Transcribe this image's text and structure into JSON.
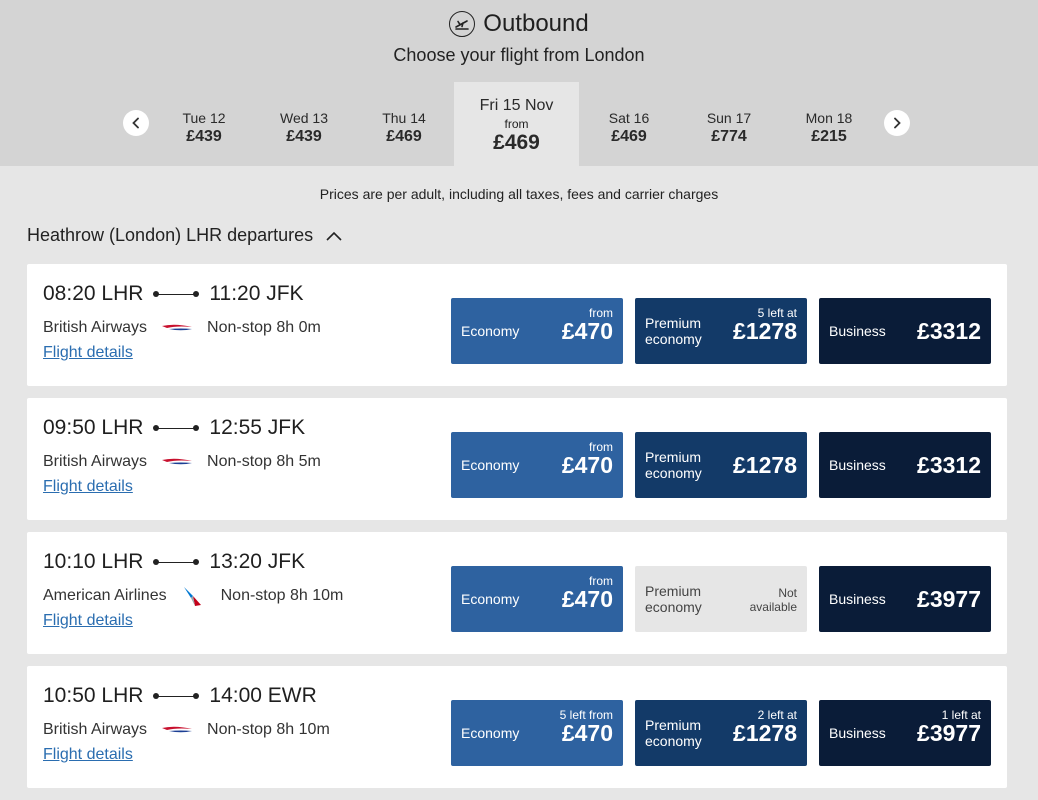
{
  "header": {
    "icon": "plane-takeoff-icon",
    "title": "Outbound",
    "subtitle": "Choose your flight from London"
  },
  "dates": [
    {
      "day": "Tue 12",
      "price": "£439"
    },
    {
      "day": "Wed 13",
      "price": "£439"
    },
    {
      "day": "Thu 14",
      "price": "£469"
    },
    {
      "day": "Fri 15 Nov",
      "from": "from",
      "price": "£469",
      "selected": true
    },
    {
      "day": "Sat 16",
      "price": "£469"
    },
    {
      "day": "Sun 17",
      "price": "£774"
    },
    {
      "day": "Mon 18",
      "price": "£215"
    }
  ],
  "notice": "Prices are per adult, including all taxes, fees and carrier charges",
  "departures_heading": "Heathrow (London) LHR departures",
  "flights": [
    {
      "depart": "08:20 LHR",
      "arrive": "11:20 JFK",
      "airline": "British Airways",
      "logo": "british-airways-logo",
      "duration": "Non-stop 8h 0m",
      "details": "Flight details",
      "economy": {
        "label": "Economy",
        "note": "from",
        "price": "£470"
      },
      "premium": {
        "label1": "Premium",
        "label2": "economy",
        "note": "5 left at",
        "price": "£1278"
      },
      "business": {
        "label": "Business",
        "note": "",
        "price": "£3312"
      }
    },
    {
      "depart": "09:50 LHR",
      "arrive": "12:55 JFK",
      "airline": "British Airways",
      "logo": "british-airways-logo",
      "duration": "Non-stop 8h 5m",
      "details": "Flight details",
      "economy": {
        "label": "Economy",
        "note": "from",
        "price": "£470"
      },
      "premium": {
        "label1": "Premium",
        "label2": "economy",
        "note": "",
        "price": "£1278"
      },
      "business": {
        "label": "Business",
        "note": "",
        "price": "£3312"
      }
    },
    {
      "depart": "10:10 LHR",
      "arrive": "13:20 JFK",
      "airline": "American Airlines",
      "logo": "american-airlines-logo",
      "duration": "Non-stop 8h 10m",
      "details": "Flight details",
      "economy": {
        "label": "Economy",
        "note": "from",
        "price": "£470"
      },
      "premium": {
        "label1": "Premium",
        "label2": "economy",
        "na1": "Not",
        "na2": "available"
      },
      "business": {
        "label": "Business",
        "note": "",
        "price": "£3977"
      }
    },
    {
      "depart": "10:50 LHR",
      "arrive": "14:00 EWR",
      "airline": "British Airways",
      "logo": "british-airways-logo",
      "duration": "Non-stop 8h 10m",
      "details": "Flight details",
      "economy": {
        "label": "Economy",
        "note": "5 left from",
        "price": "£470"
      },
      "premium": {
        "label1": "Premium",
        "label2": "economy",
        "note": "2 left at",
        "price": "£1278"
      },
      "business": {
        "label": "Business",
        "note": "1 left at",
        "price": "£3977"
      }
    }
  ],
  "colors": {
    "economy": "#2e62a0",
    "premium": "#133a68",
    "business": "#0a1c38",
    "link": "#2a6db0"
  }
}
